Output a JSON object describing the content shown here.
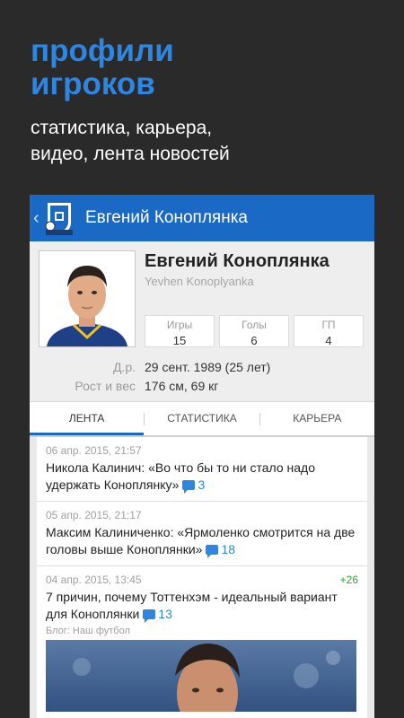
{
  "promo": {
    "title_line1": "профили",
    "title_line2": "игроков",
    "subtitle_line1": "статистика, карьера,",
    "subtitle_line2": "видео, лента новостей"
  },
  "appbar": {
    "back_icon": "chevron-left-icon",
    "logo_icon": "dnipro-club-logo-icon",
    "title": "Евгений Коноплянка"
  },
  "profile": {
    "name": "Евгений Коноплянка",
    "name_latin": "Yevhen Konoplyanka",
    "stats": [
      {
        "label": "Игры",
        "value": "15"
      },
      {
        "label": "Голы",
        "value": "6"
      },
      {
        "label": "ГП",
        "value": "4"
      }
    ],
    "dob_label": "Д.р.",
    "dob_value": "29 сент. 1989 (25 лет)",
    "size_label": "Рост и вес",
    "size_value": "176 см, 69 кг"
  },
  "tabs": [
    {
      "label": "ЛЕНТА",
      "active": true
    },
    {
      "label": "СТАТИСТИКА",
      "active": false
    },
    {
      "label": "КАРЬЕРА",
      "active": false
    }
  ],
  "feed": [
    {
      "date": "06 апр. 2015, 21:57",
      "text": "Никола Калинич: «Во что бы то ни стало надо удержать Коноплянку»",
      "comments": "3"
    },
    {
      "date": "05 апр. 2015, 21:17",
      "text": "Максим Калиниченко: «Ярмоленко смотрится на две головы выше Коноплянки»",
      "comments": "18"
    },
    {
      "date": "04 апр. 2015, 13:45",
      "delta": "+26",
      "text": "7 причин, почему Тоттенхэм - идеальный вариант для Коноплянки",
      "comments": "13",
      "source": "Блог: Наш футбол"
    }
  ],
  "colors": {
    "accent": "#1a69c4",
    "promo_blue": "#2f86e0",
    "positive": "#2aa52a"
  }
}
